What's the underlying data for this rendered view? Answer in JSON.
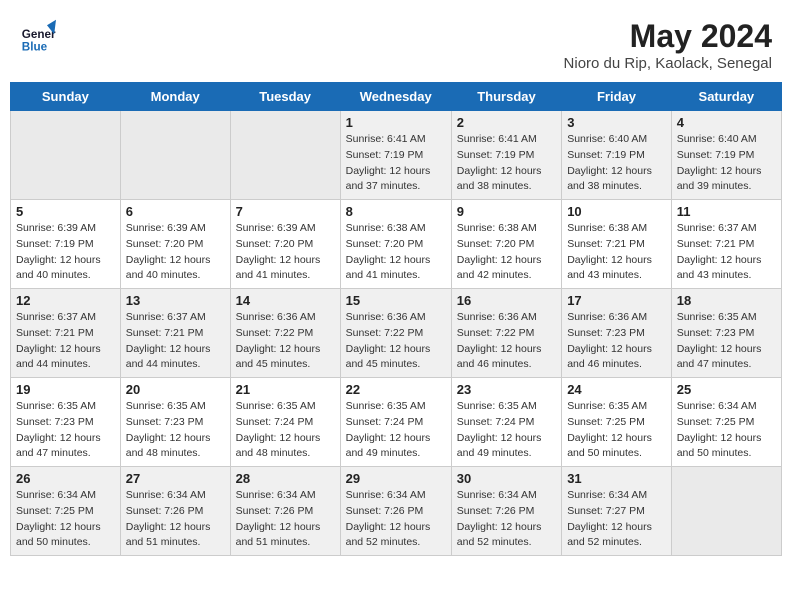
{
  "header": {
    "logo_line1": "General",
    "logo_line2": "Blue",
    "month": "May 2024",
    "location": "Nioro du Rip, Kaolack, Senegal"
  },
  "days_of_week": [
    "Sunday",
    "Monday",
    "Tuesday",
    "Wednesday",
    "Thursday",
    "Friday",
    "Saturday"
  ],
  "weeks": [
    [
      {
        "day": "",
        "sunrise": "",
        "sunset": "",
        "daylight": ""
      },
      {
        "day": "",
        "sunrise": "",
        "sunset": "",
        "daylight": ""
      },
      {
        "day": "",
        "sunrise": "",
        "sunset": "",
        "daylight": ""
      },
      {
        "day": "1",
        "sunrise": "Sunrise: 6:41 AM",
        "sunset": "Sunset: 7:19 PM",
        "daylight": "Daylight: 12 hours and 37 minutes."
      },
      {
        "day": "2",
        "sunrise": "Sunrise: 6:41 AM",
        "sunset": "Sunset: 7:19 PM",
        "daylight": "Daylight: 12 hours and 38 minutes."
      },
      {
        "day": "3",
        "sunrise": "Sunrise: 6:40 AM",
        "sunset": "Sunset: 7:19 PM",
        "daylight": "Daylight: 12 hours and 38 minutes."
      },
      {
        "day": "4",
        "sunrise": "Sunrise: 6:40 AM",
        "sunset": "Sunset: 7:19 PM",
        "daylight": "Daylight: 12 hours and 39 minutes."
      }
    ],
    [
      {
        "day": "5",
        "sunrise": "Sunrise: 6:39 AM",
        "sunset": "Sunset: 7:19 PM",
        "daylight": "Daylight: 12 hours and 40 minutes."
      },
      {
        "day": "6",
        "sunrise": "Sunrise: 6:39 AM",
        "sunset": "Sunset: 7:20 PM",
        "daylight": "Daylight: 12 hours and 40 minutes."
      },
      {
        "day": "7",
        "sunrise": "Sunrise: 6:39 AM",
        "sunset": "Sunset: 7:20 PM",
        "daylight": "Daylight: 12 hours and 41 minutes."
      },
      {
        "day": "8",
        "sunrise": "Sunrise: 6:38 AM",
        "sunset": "Sunset: 7:20 PM",
        "daylight": "Daylight: 12 hours and 41 minutes."
      },
      {
        "day": "9",
        "sunrise": "Sunrise: 6:38 AM",
        "sunset": "Sunset: 7:20 PM",
        "daylight": "Daylight: 12 hours and 42 minutes."
      },
      {
        "day": "10",
        "sunrise": "Sunrise: 6:38 AM",
        "sunset": "Sunset: 7:21 PM",
        "daylight": "Daylight: 12 hours and 43 minutes."
      },
      {
        "day": "11",
        "sunrise": "Sunrise: 6:37 AM",
        "sunset": "Sunset: 7:21 PM",
        "daylight": "Daylight: 12 hours and 43 minutes."
      }
    ],
    [
      {
        "day": "12",
        "sunrise": "Sunrise: 6:37 AM",
        "sunset": "Sunset: 7:21 PM",
        "daylight": "Daylight: 12 hours and 44 minutes."
      },
      {
        "day": "13",
        "sunrise": "Sunrise: 6:37 AM",
        "sunset": "Sunset: 7:21 PM",
        "daylight": "Daylight: 12 hours and 44 minutes."
      },
      {
        "day": "14",
        "sunrise": "Sunrise: 6:36 AM",
        "sunset": "Sunset: 7:22 PM",
        "daylight": "Daylight: 12 hours and 45 minutes."
      },
      {
        "day": "15",
        "sunrise": "Sunrise: 6:36 AM",
        "sunset": "Sunset: 7:22 PM",
        "daylight": "Daylight: 12 hours and 45 minutes."
      },
      {
        "day": "16",
        "sunrise": "Sunrise: 6:36 AM",
        "sunset": "Sunset: 7:22 PM",
        "daylight": "Daylight: 12 hours and 46 minutes."
      },
      {
        "day": "17",
        "sunrise": "Sunrise: 6:36 AM",
        "sunset": "Sunset: 7:23 PM",
        "daylight": "Daylight: 12 hours and 46 minutes."
      },
      {
        "day": "18",
        "sunrise": "Sunrise: 6:35 AM",
        "sunset": "Sunset: 7:23 PM",
        "daylight": "Daylight: 12 hours and 47 minutes."
      }
    ],
    [
      {
        "day": "19",
        "sunrise": "Sunrise: 6:35 AM",
        "sunset": "Sunset: 7:23 PM",
        "daylight": "Daylight: 12 hours and 47 minutes."
      },
      {
        "day": "20",
        "sunrise": "Sunrise: 6:35 AM",
        "sunset": "Sunset: 7:23 PM",
        "daylight": "Daylight: 12 hours and 48 minutes."
      },
      {
        "day": "21",
        "sunrise": "Sunrise: 6:35 AM",
        "sunset": "Sunset: 7:24 PM",
        "daylight": "Daylight: 12 hours and 48 minutes."
      },
      {
        "day": "22",
        "sunrise": "Sunrise: 6:35 AM",
        "sunset": "Sunset: 7:24 PM",
        "daylight": "Daylight: 12 hours and 49 minutes."
      },
      {
        "day": "23",
        "sunrise": "Sunrise: 6:35 AM",
        "sunset": "Sunset: 7:24 PM",
        "daylight": "Daylight: 12 hours and 49 minutes."
      },
      {
        "day": "24",
        "sunrise": "Sunrise: 6:35 AM",
        "sunset": "Sunset: 7:25 PM",
        "daylight": "Daylight: 12 hours and 50 minutes."
      },
      {
        "day": "25",
        "sunrise": "Sunrise: 6:34 AM",
        "sunset": "Sunset: 7:25 PM",
        "daylight": "Daylight: 12 hours and 50 minutes."
      }
    ],
    [
      {
        "day": "26",
        "sunrise": "Sunrise: 6:34 AM",
        "sunset": "Sunset: 7:25 PM",
        "daylight": "Daylight: 12 hours and 50 minutes."
      },
      {
        "day": "27",
        "sunrise": "Sunrise: 6:34 AM",
        "sunset": "Sunset: 7:26 PM",
        "daylight": "Daylight: 12 hours and 51 minutes."
      },
      {
        "day": "28",
        "sunrise": "Sunrise: 6:34 AM",
        "sunset": "Sunset: 7:26 PM",
        "daylight": "Daylight: 12 hours and 51 minutes."
      },
      {
        "day": "29",
        "sunrise": "Sunrise: 6:34 AM",
        "sunset": "Sunset: 7:26 PM",
        "daylight": "Daylight: 12 hours and 52 minutes."
      },
      {
        "day": "30",
        "sunrise": "Sunrise: 6:34 AM",
        "sunset": "Sunset: 7:26 PM",
        "daylight": "Daylight: 12 hours and 52 minutes."
      },
      {
        "day": "31",
        "sunrise": "Sunrise: 6:34 AM",
        "sunset": "Sunset: 7:27 PM",
        "daylight": "Daylight: 12 hours and 52 minutes."
      },
      {
        "day": "",
        "sunrise": "",
        "sunset": "",
        "daylight": ""
      }
    ]
  ]
}
